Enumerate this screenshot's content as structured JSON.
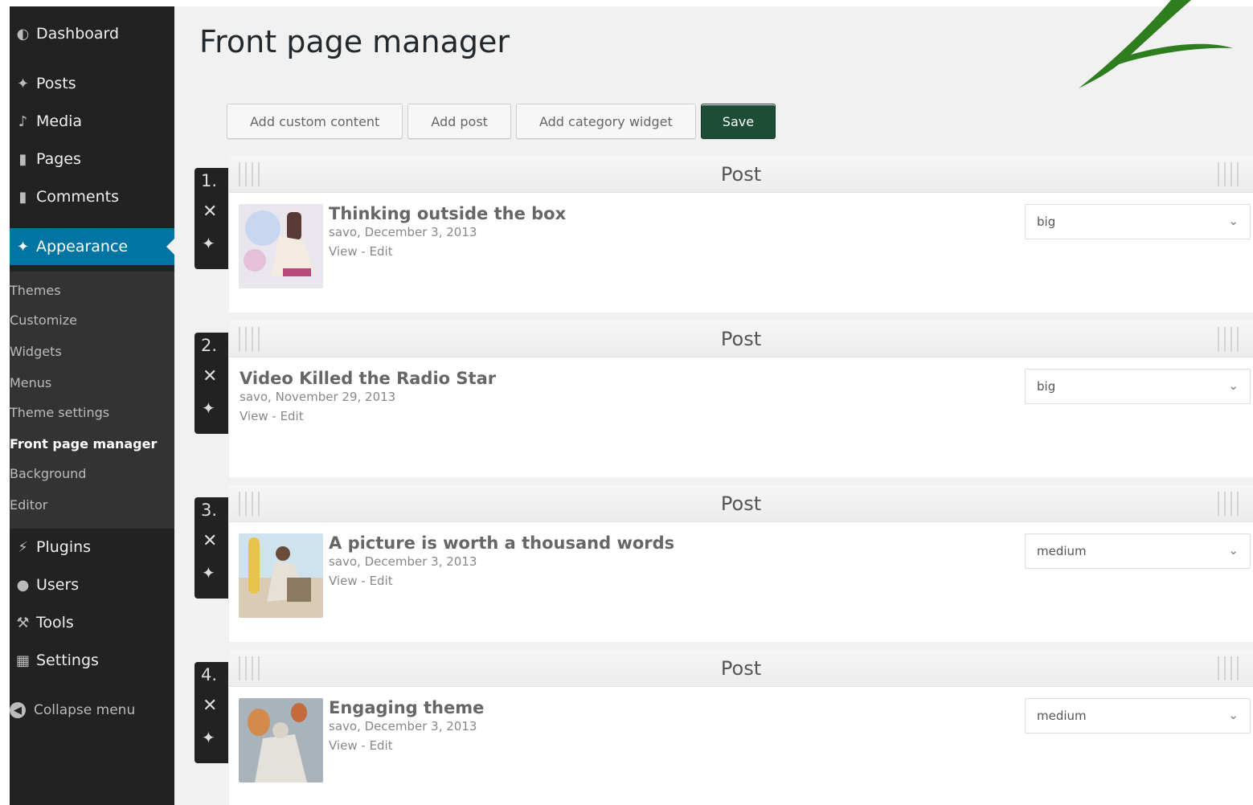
{
  "sidebar": {
    "menu": [
      {
        "label": "Dashboard",
        "icon": "dashboard-icon"
      },
      {
        "label": "Posts",
        "icon": "pin-icon"
      },
      {
        "label": "Media",
        "icon": "media-icon"
      },
      {
        "label": "Pages",
        "icon": "pages-icon"
      },
      {
        "label": "Comments",
        "icon": "comments-icon"
      },
      {
        "label": "Appearance",
        "icon": "paintbrush-icon"
      },
      {
        "label": "Plugins",
        "icon": "plug-icon"
      },
      {
        "label": "Users",
        "icon": "users-icon"
      },
      {
        "label": "Tools",
        "icon": "wrench-icon"
      },
      {
        "label": "Settings",
        "icon": "settings-icon"
      }
    ],
    "submenu": [
      "Themes",
      "Customize",
      "Widgets",
      "Menus",
      "Theme settings",
      "Front page manager",
      "Background",
      "Editor"
    ],
    "current_submenu": "Front page manager",
    "collapse_label": "Collapse menu"
  },
  "header": {
    "title": "Front page manager"
  },
  "toolbar": {
    "add_custom_content": "Add custom content",
    "add_post": "Add post",
    "add_category_widget": "Add category widget",
    "save": "Save"
  },
  "items": [
    {
      "number": "1.",
      "type": "Post",
      "title": "Thinking outside the box",
      "meta": "savo, December 3, 2013",
      "view": "View",
      "sep": " - ",
      "edit": "Edit",
      "size": "big",
      "has_thumb": true
    },
    {
      "number": "2.",
      "type": "Post",
      "title": "Video Killed the Radio Star",
      "meta": "savo, November 29, 2013",
      "view": "View",
      "sep": " - ",
      "edit": "Edit",
      "size": "big",
      "has_thumb": false
    },
    {
      "number": "3.",
      "type": "Post",
      "title": "A picture is worth a thousand words",
      "meta": "savo, December 3, 2013",
      "view": "View",
      "sep": " - ",
      "edit": "Edit",
      "size": "medium",
      "has_thumb": true
    },
    {
      "number": "4.",
      "type": "Post",
      "title": "Engaging theme",
      "meta": "savo, December 3, 2013",
      "view": "View",
      "sep": " - ",
      "edit": "Edit",
      "size": "medium",
      "has_thumb": true
    }
  ],
  "colors": {
    "sidebar_bg": "#222222",
    "active_menu": "#0074a2",
    "save_button": "#1d4d37",
    "logo_green": "#2e7d1e"
  }
}
